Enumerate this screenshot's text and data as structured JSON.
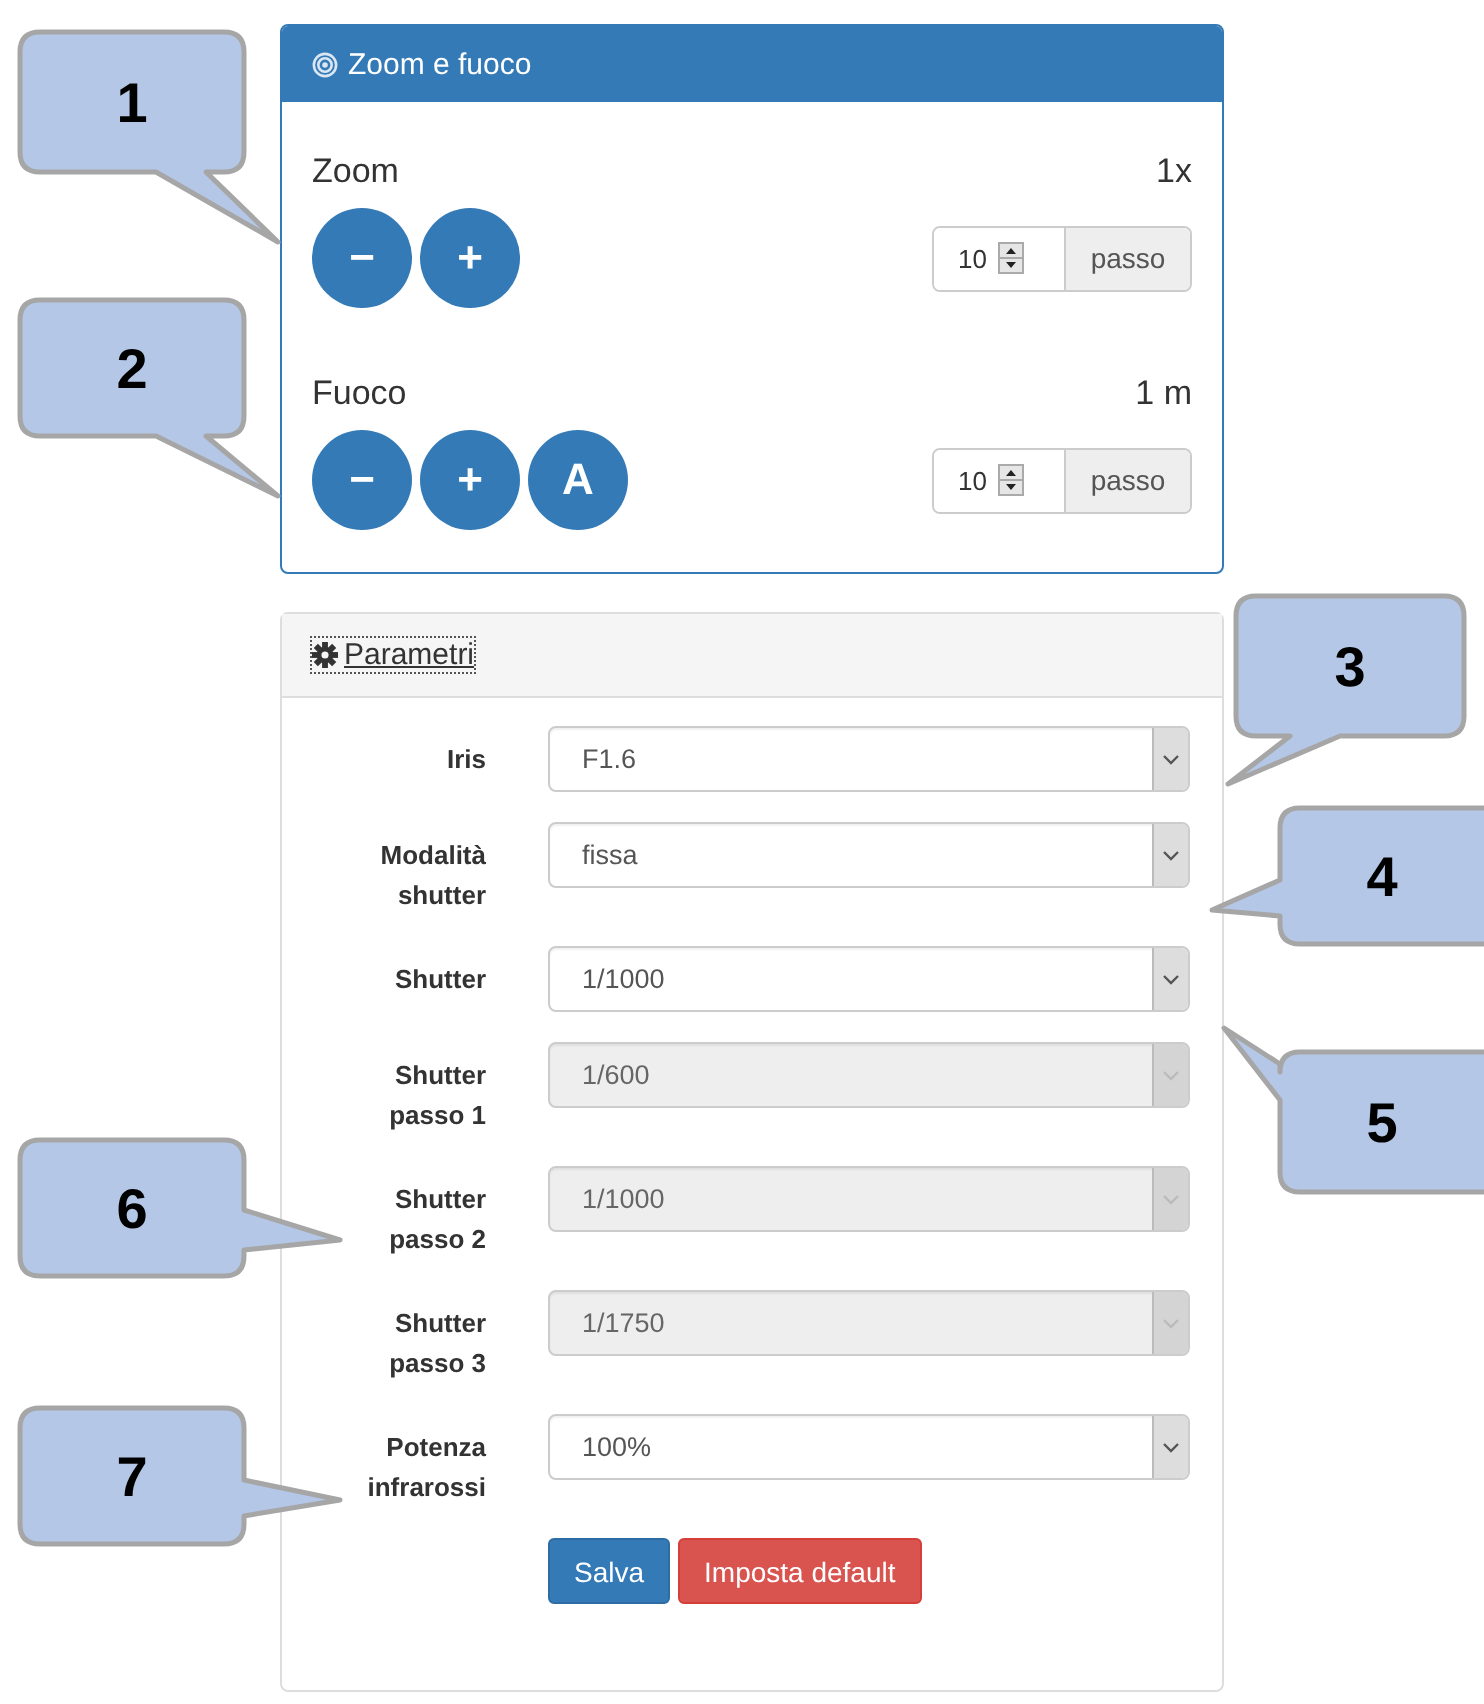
{
  "zoom_panel": {
    "title": "Zoom e fuoco",
    "controls": [
      {
        "label": "Zoom",
        "reading": "1x",
        "buttons": [
          "−",
          "+"
        ],
        "step": {
          "value": "10",
          "addon": "passo"
        }
      },
      {
        "label": "Fuoco",
        "reading": "1 m",
        "buttons": [
          "−",
          "+",
          "A"
        ],
        "step": {
          "value": "10",
          "addon": "passo"
        }
      }
    ]
  },
  "params_panel": {
    "title": "Parametri",
    "fields": [
      {
        "label": "Iris",
        "value": "F1.6",
        "disabled": false
      },
      {
        "label": "Modalità shutter",
        "value": "fissa",
        "disabled": false
      },
      {
        "label": "Shutter",
        "value": "1/1000",
        "disabled": false
      },
      {
        "label": "Shutter passo 1",
        "value": "1/600",
        "disabled": true
      },
      {
        "label": "Shutter passo 2",
        "value": "1/1000",
        "disabled": true
      },
      {
        "label": "Shutter passo 3",
        "value": "1/1750",
        "disabled": true
      },
      {
        "label": "Potenza infrarossi",
        "value": "100%",
        "disabled": false
      }
    ],
    "buttons": [
      {
        "label": "Salva",
        "kind": "primary"
      },
      {
        "label": "Imposta default",
        "kind": "danger"
      }
    ]
  },
  "callouts": [
    "1",
    "2",
    "3",
    "4",
    "5",
    "6",
    "7"
  ]
}
